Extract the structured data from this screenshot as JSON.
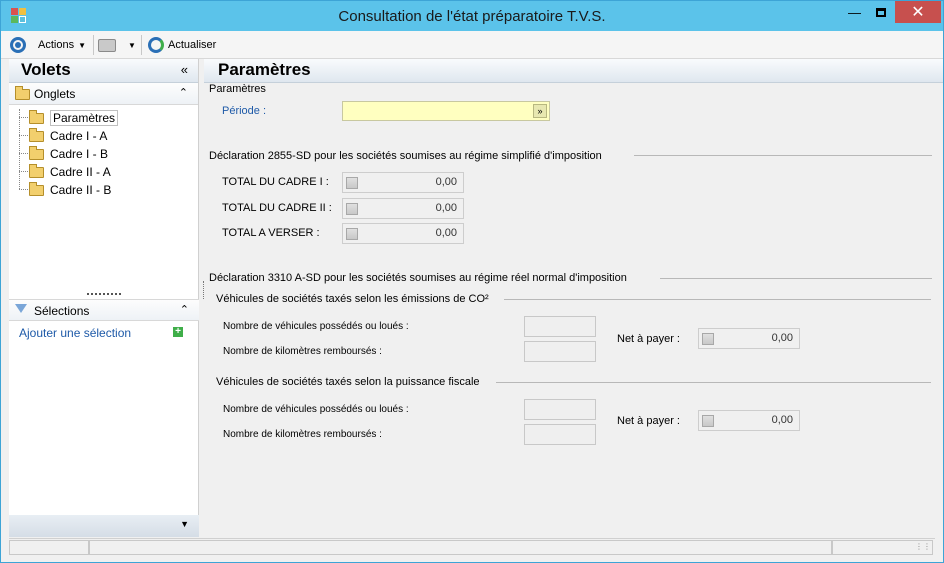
{
  "window": {
    "title": "Consultation de l'état préparatoire T.V.S."
  },
  "toolbar": {
    "actions_label": "Actions",
    "refresh_label": "Actualiser"
  },
  "left_pane": {
    "title": "Volets",
    "tabs_header": "Onglets",
    "tree": [
      "Paramètres",
      "Cadre I - A",
      "Cadre I - B",
      "Cadre II - A",
      "Cadre II - B"
    ],
    "selections_header": "Sélections",
    "add_selection": "Ajouter une sélection"
  },
  "main": {
    "title": "Paramètres",
    "params_group": "Paramètres",
    "period_label": "Période :",
    "period_value": "",
    "section1": {
      "title": "Déclaration 2855-SD pour les sociétés soumises au régime simplifié d'imposition",
      "rows": [
        {
          "label": "TOTAL DU CADRE I :",
          "value": "0,00"
        },
        {
          "label": "TOTAL DU CADRE II :",
          "value": "0,00"
        },
        {
          "label": "TOTAL A VERSER :",
          "value": "0,00"
        }
      ]
    },
    "section2": {
      "title": "Déclaration 3310 A-SD pour les sociétés soumises au régime réel normal d'imposition",
      "sub1": {
        "title": "Véhicules de sociétés taxés selon les émissions de CO²",
        "vehicles_label": "Nombre de véhicules possédés ou loués :",
        "km_label": "Nombre de kilomètres remboursés :",
        "net_label": "Net à payer :",
        "net_value": "0,00"
      },
      "sub2": {
        "title": "Véhicules de sociétés taxés selon la puissance fiscale",
        "vehicles_label": "Nombre de véhicules possédés ou loués :",
        "km_label": "Nombre de kilomètres remboursés :",
        "net_label": "Net à payer :",
        "net_value": "0,00"
      }
    }
  }
}
